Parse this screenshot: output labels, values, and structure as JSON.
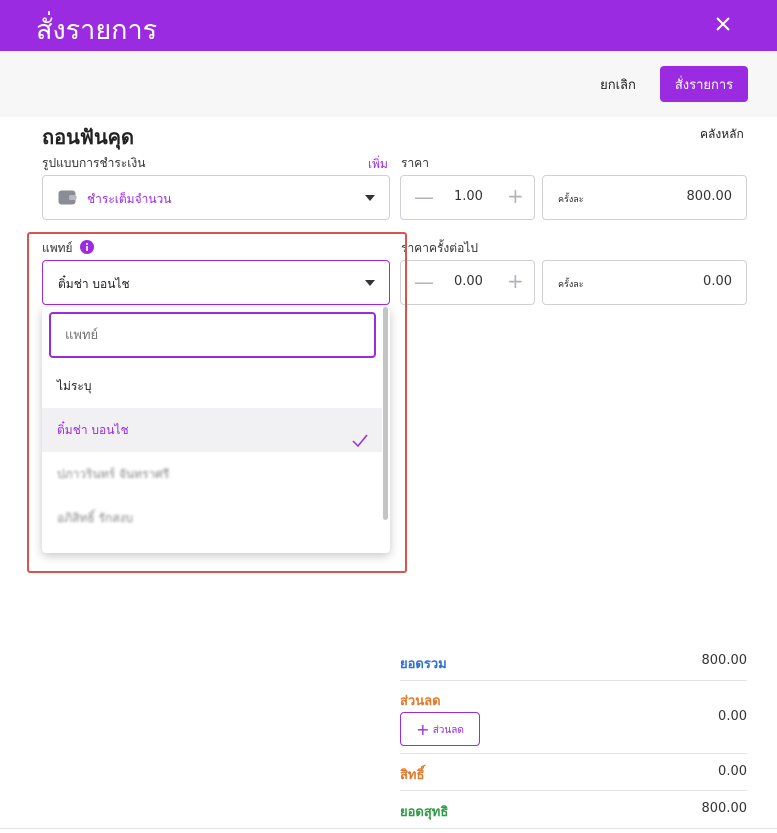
{
  "header": {
    "title": "สั่งรายการ"
  },
  "toolbar": {
    "cancel_label": "ยกเลิก",
    "order_label": "สั่งรายการ"
  },
  "item": {
    "name": "ถอนฟันคุด",
    "warehouse": "คลังหลัก"
  },
  "payment": {
    "label": "รูปแบบการชำระเงิน",
    "add_label": "เพิ่ม",
    "value": "ชำระเต็มจำนวน"
  },
  "price": {
    "label": "ราคา",
    "qty": "1.00",
    "unit": "ครั้งละ",
    "amount": "800.00"
  },
  "doctor": {
    "label": "แพทย์",
    "value": "ติ๋มช่า บอนไช",
    "search_placeholder": "แพทย์",
    "options": [
      {
        "label": "ไม่ระบุ"
      },
      {
        "label": "ติ๋มช่า บอนไช"
      },
      {
        "label": "ปภาวรินทร์ จันทราศรี"
      },
      {
        "label": "อภิสิทธิ์ รักสงบ"
      }
    ]
  },
  "next_price": {
    "label": "ราคาครั้งต่อไป",
    "qty": "0.00",
    "unit": "ครั้งละ",
    "amount": "0.00"
  },
  "summary": {
    "total_label": "ยอดรวม",
    "total_value": "800.00",
    "discount_label": "ส่วนลด",
    "discount_button": "ส่วนลด",
    "discount_value": "0.00",
    "rights_label": "สิทธิ์",
    "rights_value": "0.00",
    "net_label": "ยอดสุทธิ",
    "net_value": "800.00"
  },
  "colors": {
    "accent": "#9b2be0",
    "total": "#2c6fd6",
    "discount": "#e07a2a",
    "net": "#2e9b46",
    "highlight": "#d9534f"
  }
}
